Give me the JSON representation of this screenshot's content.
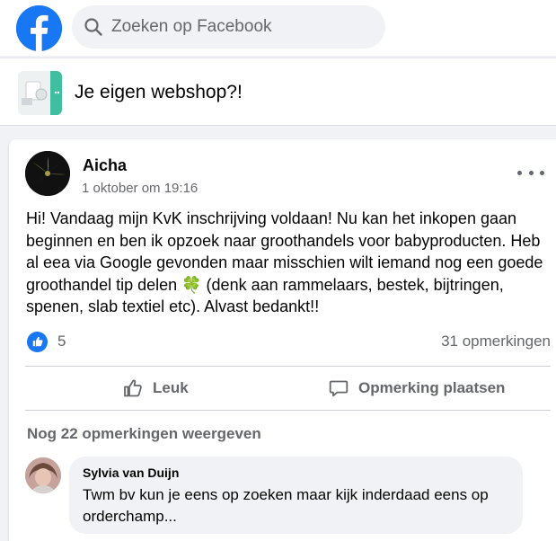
{
  "header": {
    "logo_icon": "facebook-logo-icon",
    "search": {
      "placeholder": "Zoeken op Facebook",
      "icon": "search-icon"
    }
  },
  "group": {
    "title": "Je eigen webshop?!",
    "thumbnail_icon": "group-cover-image"
  },
  "post": {
    "author": "Aicha",
    "timestamp": "1 oktober om 19:16",
    "menu_icon": "more-options-icon",
    "text": "Hi! Vandaag mijn KvK inschrijving voldaan! Nu kan het inkopen gaan beginnen en ben ik opzoek naar groothandels voor babyproducten. Heb al eea via Google gevonden maar misschien wilt iemand nog een goede groothandel tip delen 🍀 (denk aan rammelaars, bestek, bijtringen, spenen, slab textiel etc). Alvast bedankt!!",
    "reactions": {
      "count": "5",
      "icon": "like-reaction-icon"
    },
    "comments_count": "31 opmerkingen",
    "actions": {
      "like_label": "Leuk",
      "comment_label": "Opmerking plaatsen"
    },
    "view_more_comments": "Nog 22 opmerkingen weergeven"
  },
  "comment": {
    "author": "Sylvia van Duijn",
    "text": "Twm bv kun je eens op zoeken maar kijk inderdaad eens op orderchamp..."
  },
  "colors": {
    "brand": "#1877f2",
    "page_bg": "#f0f2f5",
    "secondary_text": "#65676b"
  }
}
